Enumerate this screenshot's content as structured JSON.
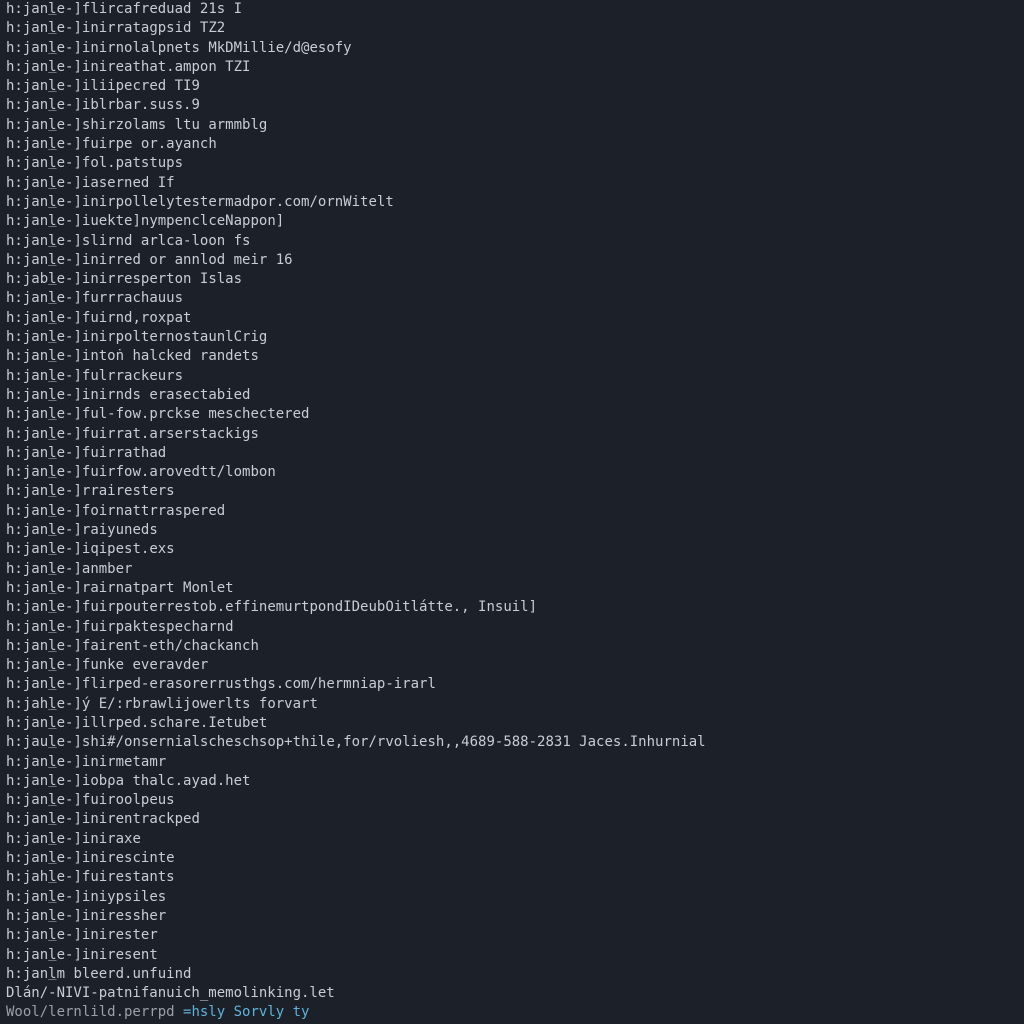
{
  "lines": [
    {
      "prefix": "h:janle-]",
      "content": "flircafreduad 21s I"
    },
    {
      "prefix": "h:janle-]",
      "content": "inirratagpsid TZ2"
    },
    {
      "prefix": "h:janle-]",
      "content": "inirnolalpnets MkDMillie/d@esofy"
    },
    {
      "prefix": "h:janle-]",
      "content": "inireathat.ampon TZI"
    },
    {
      "prefix": "h:janle-]",
      "content": "iliipecred TI9"
    },
    {
      "prefix": "h:janle-]",
      "content": "iblrbar.suss.9"
    },
    {
      "prefix": "h:janle-]",
      "content": "shirzolams ltu armmblg"
    },
    {
      "prefix": "h:janle-]",
      "content": "fuirpe or.ayanch"
    },
    {
      "prefix": "h:janle-]",
      "content": "fol.patstups"
    },
    {
      "prefix": "h:janle-]",
      "content": "iaserned If"
    },
    {
      "prefix": "h:janle-]",
      "content": "inirpollelytestermadpor.com/ornWitelt"
    },
    {
      "prefix": "h:janle-]",
      "content": "iuekte]nympenclceNappon]"
    },
    {
      "prefix": "h:janle-]",
      "content": "slirnd arlca-loon fs"
    },
    {
      "prefix": "h:janle-]",
      "content": "inirred or annlod meir 16"
    },
    {
      "prefix": "h:jable-]",
      "content": "inirresperton Islas"
    },
    {
      "prefix": "h:janle-]",
      "content": "furrrachauus"
    },
    {
      "prefix": "h:janle-]",
      "content": "fuirnd,roxpat"
    },
    {
      "prefix": "h:janle-]",
      "content": "inirpolternostaunlCrig"
    },
    {
      "prefix": "h:janle-]",
      "content": "intoṅ halcked randets"
    },
    {
      "prefix": "h:janle-]",
      "content": "fulrrackeurs"
    },
    {
      "prefix": "h:janle-]",
      "content": "inirnds erasectabied"
    },
    {
      "prefix": "h:janle-]",
      "content": "ful-fow.prckse meschectered"
    },
    {
      "prefix": "h:janle-]",
      "content": "fuirrat.arserstackigs"
    },
    {
      "prefix": "h:janle-]",
      "content": "fuirrathad"
    },
    {
      "prefix": "h:janle-]",
      "content": "fuirfow.arovedtt/lombon"
    },
    {
      "prefix": "h:janle-]",
      "content": "rrairesters"
    },
    {
      "prefix": "h:janle-]",
      "content": "foirnattrraspered"
    },
    {
      "prefix": "h:janle-]",
      "content": "raiyuneds"
    },
    {
      "prefix": "h:janle-]",
      "content": "iqipest.exs"
    },
    {
      "prefix": "h:janle-]",
      "content": "anmber"
    },
    {
      "prefix": "h:janle-]",
      "content": "rairnatpart Monlet"
    },
    {
      "prefix": "h:janle-]",
      "content": "fuirpouterrestob.effinemurtpondIDeubOitlátte., Insuil]"
    },
    {
      "prefix": "h:janle-]",
      "content": "fuirpaktespecharnd"
    },
    {
      "prefix": "h:janle-]",
      "content": "fairent-eth/chackanch"
    },
    {
      "prefix": "h:janle-]",
      "content": "funke everavder"
    },
    {
      "prefix": "h:janle-]",
      "content": "flirped-erasorerrusthgs.com/hermniap-irarl"
    },
    {
      "prefix": "h:jahle-]",
      "content": "ý E/:rbrawlijowerlts forvart"
    },
    {
      "prefix": "h:janle-]",
      "content": "illrped.schare.Ietubet"
    },
    {
      "prefix": "h:jaule-]",
      "content": "shi#/onsernialscheschsop+thile,for/rvoliesh,,4689-588-2831 Jaces.Inhurnial"
    },
    {
      "prefix": "h:janle-]",
      "content": "inirmetamr"
    },
    {
      "prefix": "h:janle-]",
      "content": "iobρa thalc.ayad.het"
    },
    {
      "prefix": "h:janle-]",
      "content": "fuiroolpeus"
    },
    {
      "prefix": "h:janle-]",
      "content": "inirentrackped"
    },
    {
      "prefix": "h:janle-]",
      "content": "iniraxe"
    },
    {
      "prefix": "h:janle-]",
      "content": "inirescinte"
    },
    {
      "prefix": "h:jahle-]",
      "content": "fuirestants"
    },
    {
      "prefix": "h:janle-]",
      "content": "iniypsiles"
    },
    {
      "prefix": "h:janle-]",
      "content": "iniressher"
    },
    {
      "prefix": "h:janle-]",
      "content": "inirester"
    },
    {
      "prefix": "h:janle-]",
      "content": "iniresent"
    },
    {
      "prefix": "h:janlm ",
      "content": "bleerd.unfuind"
    }
  ],
  "pathline": "Dlán/-NIVI-patnifanuich_memolinking.let",
  "prompt": {
    "dir": "Wool/lernlild.perrpd ",
    "cmd": "=hsly ",
    "arg": "Sorvly ty"
  }
}
